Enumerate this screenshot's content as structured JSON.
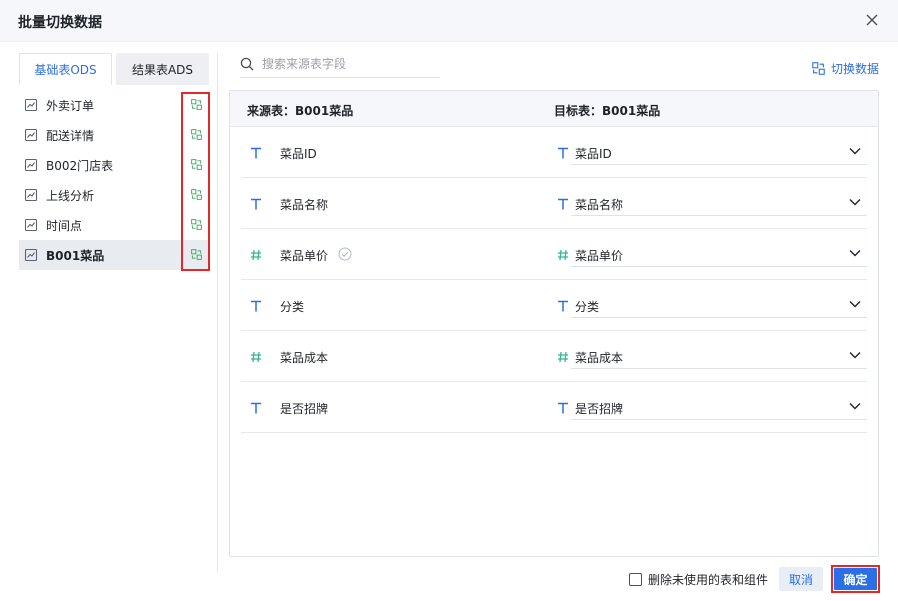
{
  "dialog": {
    "title": "批量切换数据"
  },
  "tabs": [
    {
      "label": "基础表ODS",
      "active": true
    },
    {
      "label": "结果表ADS",
      "active": false
    }
  ],
  "tables": [
    {
      "label": "外卖订单",
      "selected": false
    },
    {
      "label": "配送详情",
      "selected": false
    },
    {
      "label": "B002门店表",
      "selected": false
    },
    {
      "label": "上线分析",
      "selected": false
    },
    {
      "label": "时间点",
      "selected": false
    },
    {
      "label": "B001菜品",
      "selected": true
    }
  ],
  "search": {
    "placeholder": "搜索来源表字段"
  },
  "switch_data": {
    "label": "切换数据"
  },
  "mapping": {
    "source_header": "来源表：B001菜品",
    "target_header": "目标表：B001菜品",
    "rows": [
      {
        "type": "text",
        "source": "菜品ID",
        "target": "菜品ID",
        "checked": false
      },
      {
        "type": "text",
        "source": "菜品名称",
        "target": "菜品名称",
        "checked": false
      },
      {
        "type": "number",
        "source": "菜品单价",
        "target": "菜品单价",
        "checked": true
      },
      {
        "type": "text",
        "source": "分类",
        "target": "分类",
        "checked": false
      },
      {
        "type": "number",
        "source": "菜品成本",
        "target": "菜品成本",
        "checked": false
      },
      {
        "type": "text",
        "source": "是否招牌",
        "target": "是否招牌",
        "checked": false
      }
    ]
  },
  "footer": {
    "delete_unused_label": "删除未使用的表和组件",
    "cancel_label": "取消",
    "ok_label": "确定"
  },
  "colors": {
    "accent": "#2a6ee8",
    "highlight_border": "#e5272b",
    "switch_icon": "#3aa55d",
    "number_icon": "#35b594"
  }
}
